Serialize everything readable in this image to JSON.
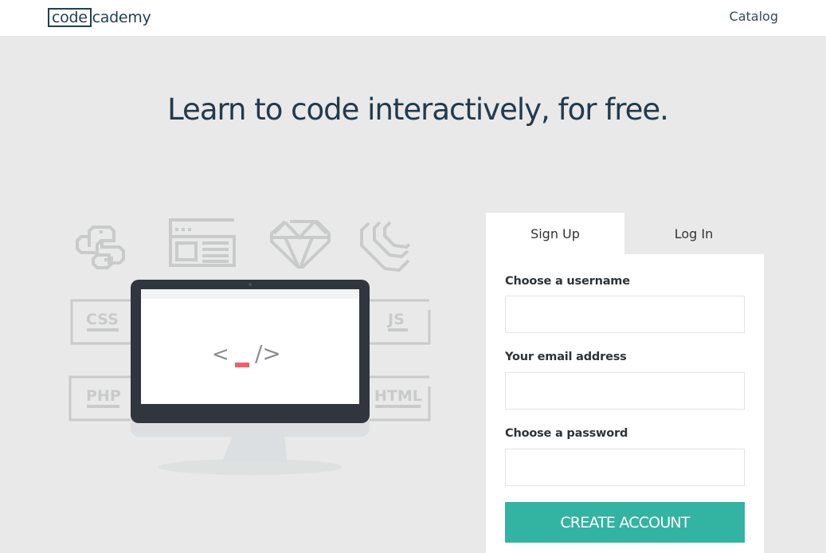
{
  "header": {
    "logo": {
      "boxed": "code",
      "rest": "cademy"
    },
    "nav": {
      "catalog_label": "Catalog"
    }
  },
  "hero": {
    "headline": "Learn to code interactively, for free."
  },
  "illustration": {
    "language_icons": [
      "python-icon",
      "web-page-icon",
      "ruby-gem-icon",
      "jquery-icon"
    ],
    "language_labels": [
      "CSS",
      "JS",
      "PHP",
      "HTML"
    ],
    "screen_glyph": {
      "left": "<",
      "cursor": "_",
      "right": "/>"
    },
    "colors": {
      "monitor_frame": "#30353e",
      "cursor": "#f25f65",
      "icon_gray": "#c9cbcb",
      "glyph_gray": "#8a8d91"
    }
  },
  "auth": {
    "tabs": [
      {
        "label": "Sign Up",
        "active": true
      },
      {
        "label": "Log In",
        "active": false
      }
    ],
    "fields": [
      {
        "label": "Choose a username",
        "value": "",
        "placeholder": "",
        "type": "text"
      },
      {
        "label": "Your email address",
        "value": "",
        "placeholder": "",
        "type": "email"
      },
      {
        "label": "Choose a password",
        "value": "",
        "placeholder": "",
        "type": "password"
      }
    ],
    "submit_label": "CREATE ACCOUNT",
    "accent_color": "#33b3a2"
  }
}
